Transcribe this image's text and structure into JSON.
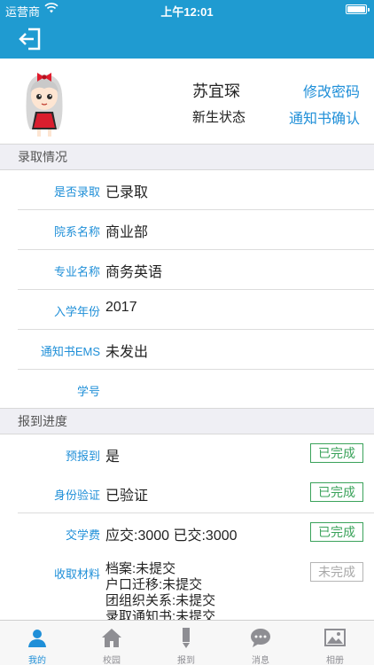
{
  "status_bar": {
    "carrier": "运营商",
    "time": "上午12:01"
  },
  "profile": {
    "name": "苏宜琛",
    "status": "新生状态",
    "change_password": "修改密码",
    "notice_confirm": "通知书确认"
  },
  "admission": {
    "header": "录取情况",
    "rows": [
      {
        "label": "是否录取",
        "value": "已录取"
      },
      {
        "label": "院系名称",
        "value": "商业部"
      },
      {
        "label": "专业名称",
        "value": "商务英语"
      },
      {
        "label": "入学年份",
        "value": "2017"
      },
      {
        "label": "通知书EMS",
        "value": "未发出"
      },
      {
        "label": "学号",
        "value": ""
      }
    ]
  },
  "progress": {
    "header": "报到进度",
    "rows": [
      {
        "label": "预报到",
        "value": "是",
        "badge": "已完成"
      },
      {
        "label": "身份验证",
        "value": "已验证",
        "badge": "已完成"
      },
      {
        "label": "交学费",
        "value": "应交:3000 已交:3000",
        "badge": "已完成"
      }
    ],
    "materials": {
      "label": "收取材料",
      "lines": [
        "档案:未提交",
        "户口迁移:未提交",
        "团组织关系:未提交",
        "录取通知书:未提交"
      ],
      "badge": "未完成"
    }
  },
  "tabs": [
    {
      "label": "我的",
      "icon": "person-icon"
    },
    {
      "label": "校园",
      "icon": "house-icon"
    },
    {
      "label": "报到",
      "icon": "pencil-icon"
    },
    {
      "label": "消息",
      "icon": "chat-bubble-icon"
    },
    {
      "label": "相册",
      "icon": "photo-icon"
    }
  ],
  "colors": {
    "header_blue": "#1f9bd1",
    "link_blue": "#1f8fd8",
    "done_green": "#3aa25a",
    "pending_gray": "#a8a8a8"
  }
}
